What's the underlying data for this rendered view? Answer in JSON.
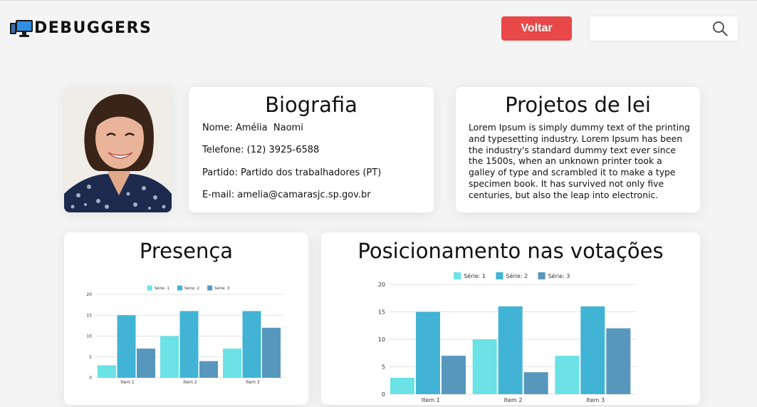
{
  "header": {
    "logo_text": "DEBUGGERS",
    "back_button_label": "Voltar",
    "search": {
      "placeholder": "",
      "value": ""
    }
  },
  "profile": {
    "photo_alt": "Amélia Naomi"
  },
  "biography": {
    "title": "Biografia",
    "fields": [
      {
        "label": "Nome:",
        "value": "Amélia  Naomi"
      },
      {
        "label": "Telefone:",
        "value": "(12) 3925-6588"
      },
      {
        "label": "Partido:",
        "value": "Partido dos trabalhadores (PT)"
      },
      {
        "label": "E-mail:",
        "value": "amelia@camarasjc.sp.gov.br"
      }
    ]
  },
  "projects": {
    "title": "Projetos de lei",
    "text": "Lorem Ipsum is simply dummy text of the printing and typesetting industry. Lorem Ipsum has been the industry's standard dummy text ever since the 1500s, when an unknown printer took a galley of type and scrambled it to make a type specimen book. It has survived not only five centuries, but also the leap into electronic."
  },
  "colors": {
    "accent_red": "#e94848",
    "series": [
      "#6ae2e6",
      "#41b4d6",
      "#5797bd"
    ]
  },
  "chart_data": [
    {
      "type": "bar",
      "title": "Presença",
      "categories": [
        "Item 1",
        "Item 2",
        "Item 3"
      ],
      "series": [
        {
          "name": "Série: 1",
          "values": [
            3,
            10,
            7
          ]
        },
        {
          "name": "Série: 2",
          "values": [
            15,
            16,
            16
          ]
        },
        {
          "name": "Série: 3",
          "values": [
            7,
            4,
            12
          ]
        }
      ],
      "ylim": [
        0,
        20
      ],
      "yticks": [
        0,
        5,
        10,
        15,
        20
      ],
      "grid": true,
      "legend": "top-center"
    },
    {
      "type": "bar",
      "title": "Posicionamento nas votações",
      "categories": [
        "Item 1",
        "Item 2",
        "Item 3"
      ],
      "series": [
        {
          "name": "Série: 1",
          "values": [
            3,
            10,
            7
          ]
        },
        {
          "name": "Série: 2",
          "values": [
            15,
            16,
            16
          ]
        },
        {
          "name": "Série: 3",
          "values": [
            7,
            4,
            12
          ]
        }
      ],
      "ylim": [
        0,
        20
      ],
      "yticks": [
        0,
        5,
        10,
        15,
        20
      ],
      "grid": true,
      "legend": "top-center"
    }
  ]
}
